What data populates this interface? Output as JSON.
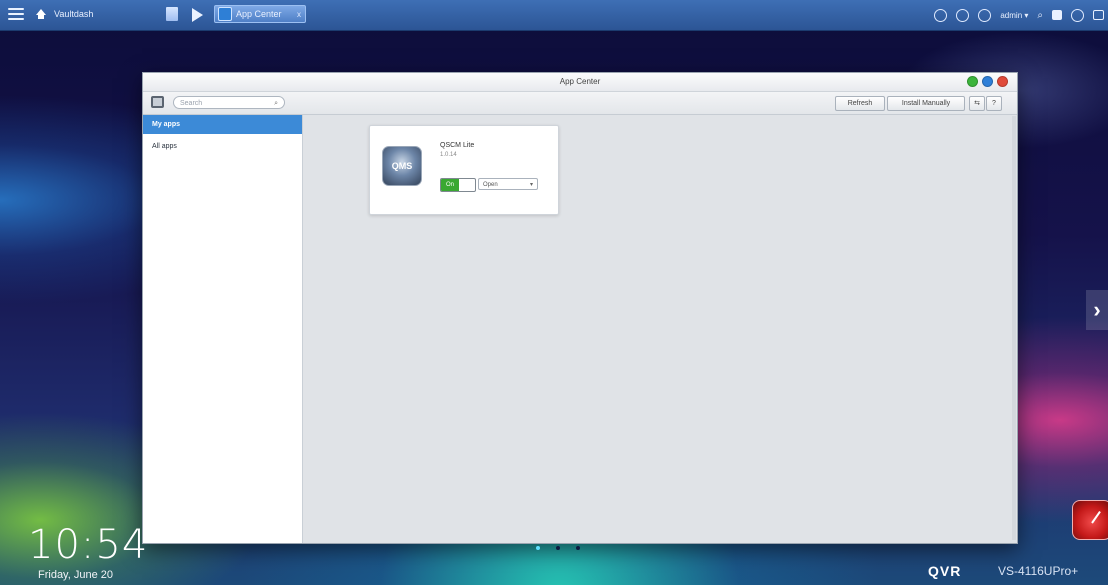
{
  "taskbar": {
    "dashboard_label": "Vaultdash",
    "app_tab_label": "App Center",
    "app_tab_close": "x",
    "user_label": "admin ▾",
    "icons": [
      "menu-icon",
      "home-icon",
      "monitor-icon",
      "play-icon",
      "app-center-icon",
      "clock-icon",
      "chat-icon",
      "info-icon",
      "search-icon",
      "options-icon",
      "globe-icon",
      "dashboard-icon"
    ]
  },
  "window": {
    "title": "App Center",
    "controls": [
      "minimize",
      "maximize",
      "close"
    ],
    "control_colors": [
      "#3cb43c",
      "#2f7fd8",
      "#e04a3a"
    ],
    "search_placeholder": "Search",
    "refresh_label": "Refresh",
    "install_manually_label": "Install Manually",
    "help_label": "?",
    "extra_label": "⇆"
  },
  "sidebar": {
    "items": [
      {
        "label": "My apps",
        "selected": true
      },
      {
        "label": "All apps",
        "selected": false
      }
    ]
  },
  "apps": [
    {
      "name": "QSCM Lite",
      "version": "1.0.14",
      "logo_text": "QMS",
      "toggle_on_label": "On",
      "open_label": "Open",
      "enabled": true
    }
  ],
  "desktop": {
    "time": "10:54",
    "date": "Friday, June 20",
    "brand": "QVR",
    "model": "VS-4116UPro+",
    "page_dots": 3,
    "active_dot": 0,
    "next_arrow": "›"
  },
  "colors": {
    "accent_selected": "#3c8ad7",
    "toggle_on": "#3aa832",
    "taskbar": "#3e6fb5"
  }
}
